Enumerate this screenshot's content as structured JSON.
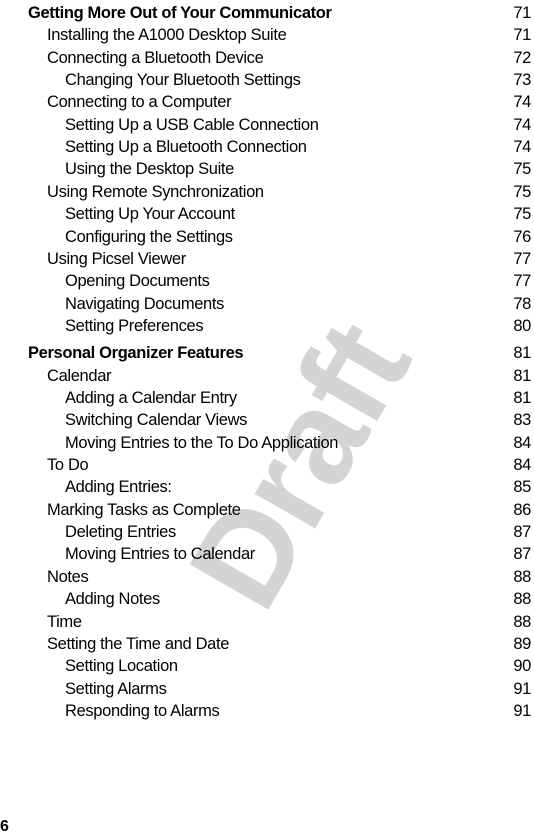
{
  "watermark": {
    "text": "Draft",
    "color": "#d4d4d4"
  },
  "toc": {
    "entries": [
      {
        "level": 0,
        "title": "Getting More Out of Your Communicator",
        "page": "71"
      },
      {
        "level": 1,
        "title": "Installing the A1000 Desktop Suite",
        "page": "71"
      },
      {
        "level": 1,
        "title": "Connecting a Bluetooth Device",
        "page": "72"
      },
      {
        "level": 2,
        "title": "Changing Your Bluetooth Settings",
        "page": "73"
      },
      {
        "level": 1,
        "title": "Connecting to a Computer",
        "page": "74"
      },
      {
        "level": 2,
        "title": "Setting Up a USB Cable Connection",
        "page": "74"
      },
      {
        "level": 2,
        "title": "Setting Up a Bluetooth Connection",
        "page": "74"
      },
      {
        "level": 2,
        "title": "Using the Desktop Suite",
        "page": "75"
      },
      {
        "level": 1,
        "title": "Using Remote Synchronization",
        "page": "75"
      },
      {
        "level": 2,
        "title": "Setting Up Your Account",
        "page": "75"
      },
      {
        "level": 2,
        "title": "Configuring the Settings",
        "page": "76"
      },
      {
        "level": 1,
        "title": "Using Picsel Viewer",
        "page": "77"
      },
      {
        "level": 2,
        "title": "Opening Documents",
        "page": "77"
      },
      {
        "level": 2,
        "title": "Navigating Documents",
        "page": "78"
      },
      {
        "level": 2,
        "title": "Setting Preferences",
        "page": "80"
      },
      {
        "level": 0,
        "title": "Personal Organizer Features",
        "page": "81"
      },
      {
        "level": 1,
        "title": "Calendar",
        "page": "81"
      },
      {
        "level": 2,
        "title": "Adding a Calendar Entry",
        "page": "81"
      },
      {
        "level": 2,
        "title": "Switching Calendar Views",
        "page": "83"
      },
      {
        "level": 2,
        "title": "Moving Entries to the To Do Application",
        "page": "84"
      },
      {
        "level": 1,
        "title": "To Do",
        "page": "84"
      },
      {
        "level": 2,
        "title": "Adding Entries:",
        "page": "85"
      },
      {
        "level": 1,
        "title": "Marking Tasks as Complete",
        "page": "86"
      },
      {
        "level": 2,
        "title": "Deleting Entries",
        "page": "87"
      },
      {
        "level": 2,
        "title": "Moving Entries to Calendar",
        "page": "87"
      },
      {
        "level": 1,
        "title": "Notes",
        "page": "88"
      },
      {
        "level": 2,
        "title": "Adding Notes",
        "page": "88"
      },
      {
        "level": 1,
        "title": "Time",
        "page": "88"
      },
      {
        "level": 1,
        "title": "Setting the Time and Date",
        "page": "89"
      },
      {
        "level": 2,
        "title": "Setting Location",
        "page": "90"
      },
      {
        "level": 2,
        "title": "Setting Alarms",
        "page": "91"
      },
      {
        "level": 2,
        "title": "Responding to Alarms",
        "page": "91"
      }
    ]
  },
  "footer": {
    "page_number": "6"
  }
}
